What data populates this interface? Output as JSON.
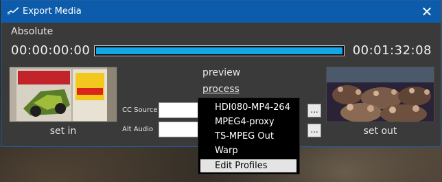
{
  "window": {
    "title": "Export Media",
    "close_symbol": "✕"
  },
  "header": {
    "mode": "Absolute"
  },
  "timeline": {
    "start_time": "00:00:00:00",
    "end_time": "00:01:32:08",
    "progress": 1.0
  },
  "actions": {
    "preview": "preview",
    "process": "process"
  },
  "thumbnails": {
    "set_in": "set in",
    "set_out": "set out"
  },
  "fields": {
    "cc_source": {
      "label": "CC Source",
      "value": "",
      "browse": "..."
    },
    "alt_audio": {
      "label": "Alt Audio",
      "value": "",
      "browse": "..."
    }
  },
  "profile_menu": {
    "items": [
      {
        "label": "HDI080-MP4-264"
      },
      {
        "label": "MPEG4-proxy"
      },
      {
        "label": "TS-MPEG Out"
      },
      {
        "label": "Warp"
      },
      {
        "label": "Edit Profiles",
        "highlighted": true
      }
    ]
  },
  "colors": {
    "titlebar": "#0c5cab",
    "progress_fill": "#13a6e8",
    "dialog_bg": "#3a3a3a"
  },
  "icons": {
    "app": "export-app-icon",
    "close": "close-icon"
  }
}
